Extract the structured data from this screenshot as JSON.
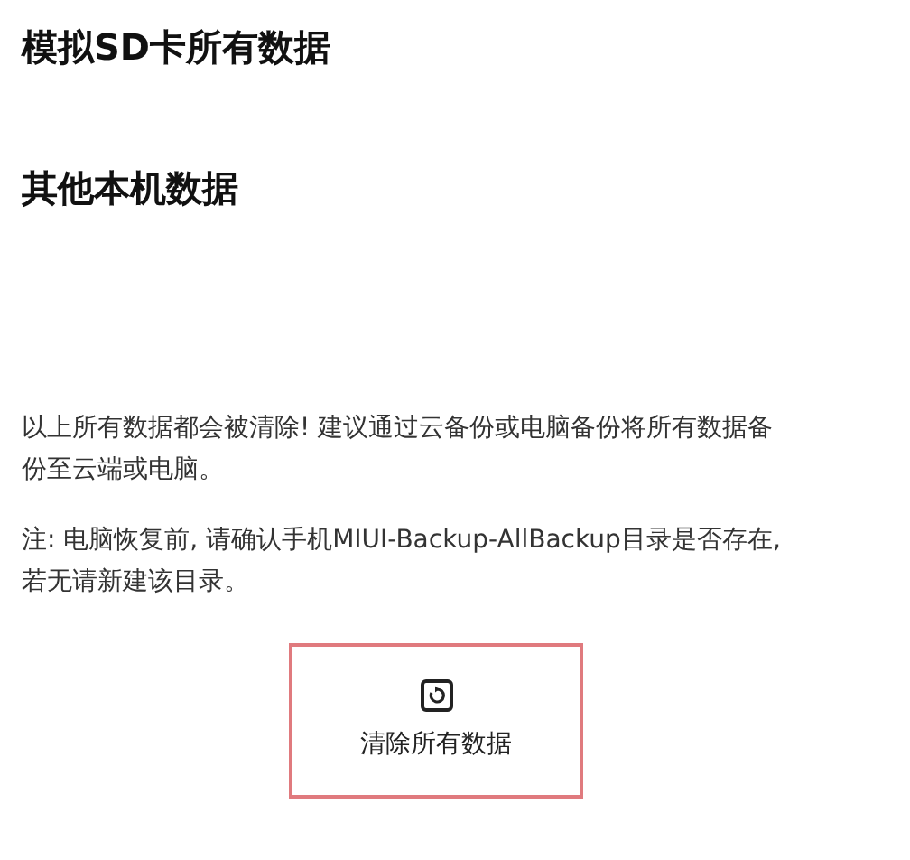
{
  "sections": [
    {
      "title": "模拟SD卡所有数据"
    },
    {
      "title": "其他本机数据"
    }
  ],
  "warning": "以上所有数据都会被清除! 建议通过云备份或电脑备份将所有数据备份至云端或电脑。",
  "note": "注: 电脑恢复前, 请确认手机MIUI-Backup-AllBackup目录是否存在, 若无请新建该目录。",
  "action_button": {
    "label": "清除所有数据"
  }
}
